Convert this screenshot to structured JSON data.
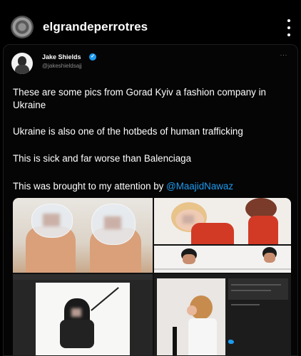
{
  "ig": {
    "username": "elgrandeperrotres"
  },
  "tweet": {
    "author_name": "Jake Shields",
    "verified_mark": "✓",
    "handle": "@jakeshieldsajj",
    "more": "···",
    "paragraphs": {
      "p1": "These are some pics from Gorad Kyiv a fashion company in Ukraine",
      "p2": "Ukraine is also one of the hotbeds of human trafficking",
      "p3": "This is sick and far worse than Balenciaga",
      "p4_prefix": "This was brought to my attention by ",
      "p4_mention": "@MaajidNawaz"
    }
  },
  "colors": {
    "background": "#000000",
    "link": "#1d9bf0",
    "verified": "#1d9bf0",
    "handle": "#8a8a8a"
  },
  "icons": [
    "more-vertical-icon",
    "verified-badge-icon",
    "more-horizontal-icon"
  ]
}
